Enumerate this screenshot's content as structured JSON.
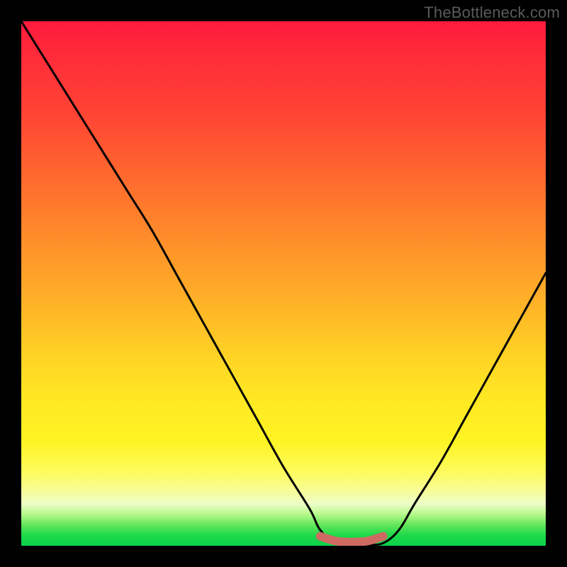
{
  "watermark": "TheBottleneck.com",
  "chart_data": {
    "type": "line",
    "title": "",
    "xlabel": "",
    "ylabel": "",
    "xlim": [
      0,
      100
    ],
    "ylim": [
      0,
      100
    ],
    "series": [
      {
        "name": "bottleneck-curve",
        "x": [
          0,
          5,
          10,
          15,
          20,
          25,
          30,
          35,
          40,
          45,
          50,
          55,
          57,
          60,
          63,
          66,
          69,
          72,
          75,
          80,
          85,
          90,
          95,
          100
        ],
        "values": [
          100,
          92,
          84,
          76,
          68,
          60,
          51,
          42,
          33,
          24,
          15,
          7,
          3,
          0.5,
          0.2,
          0.2,
          0.5,
          3,
          8,
          16,
          25,
          34,
          43,
          52
        ]
      },
      {
        "name": "valley-marker",
        "x": [
          57,
          60,
          63,
          66,
          69
        ],
        "values": [
          1.8,
          0.9,
          0.7,
          0.9,
          1.8
        ]
      }
    ],
    "annotations": [],
    "grid": false,
    "legend": false
  }
}
